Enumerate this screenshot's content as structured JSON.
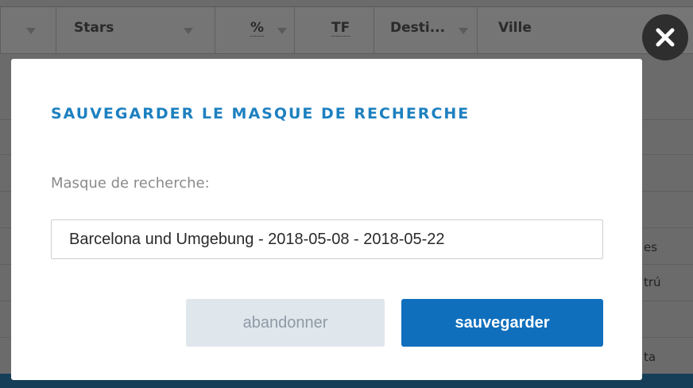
{
  "table": {
    "columns": [
      {
        "label": "",
        "filterable": true
      },
      {
        "label": "Stars",
        "filterable": true
      },
      {
        "label": "%",
        "filterable": true
      },
      {
        "label": "TF",
        "filterable": false
      },
      {
        "label": "Desti...",
        "filterable": true
      },
      {
        "label": "Ville",
        "filterable": false
      }
    ],
    "peek_cells": [
      "es",
      "trú",
      "ta"
    ]
  },
  "modal": {
    "title": "SAUVEGARDER LE MASQUE DE RECHERCHE",
    "field_label": "Masque de recherche:",
    "field_value": "Barcelona und Umgebung - 2018-05-08 - 2018-05-22",
    "cancel_label": "abandonner",
    "save_label": "sauvegarder"
  },
  "colors": {
    "title": "#1d80c0",
    "primary_button": "#0f6fbd",
    "secondary_button": "#dfe6ec",
    "overlay": "#6f6f6f"
  },
  "icons": {
    "close": "close-icon",
    "filter": "filter-icon"
  }
}
